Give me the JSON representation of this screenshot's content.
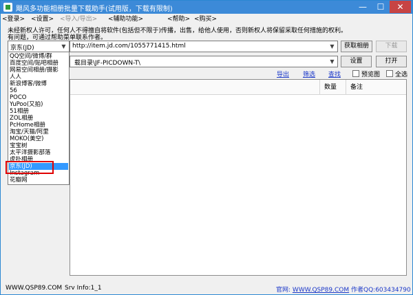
{
  "window": {
    "title": "飓风多功能相册批量下载助手(试用版，下载有限制)",
    "controls": {
      "minimize": "—",
      "maximize": "☐",
      "close": "✕"
    }
  },
  "menu": [
    {
      "label": "<登录>",
      "enabled": true
    },
    {
      "label": "<设置>",
      "enabled": true
    },
    {
      "label": "<导入/导出>",
      "enabled": false
    },
    {
      "label": "<辅助功能>",
      "enabled": true
    },
    {
      "label": "<帮助>",
      "enabled": true
    },
    {
      "label": "<购买>",
      "enabled": true
    }
  ],
  "notice": {
    "line1": "未经新权人许可，任何人不得擅自将软件(包括但不限于)传播，出售，给他人使用，否则新权人将保留采取任何措施的权利。",
    "line2": "有问题，可通过帮助菜单联系作者。"
  },
  "source": {
    "selected": "京东(JD)",
    "url": "http://item.jd.com/1055771415.html",
    "fetch_button": "获取相册",
    "download_button": "下载"
  },
  "save": {
    "path_fragment": "载目录\\JF-PICDOWN-T\\",
    "settings_button": "设置",
    "open_button": "打开"
  },
  "actions": {
    "export": "导出",
    "filter": "筛选",
    "find": "查找",
    "preview_label": "预览图",
    "select_all_label": "全选"
  },
  "table": {
    "columns": [
      "数量",
      "备注"
    ]
  },
  "dropdown_options": [
    "QQ空间/微博/群",
    "百度空间/贴吧相册",
    "网易空间相册/摄影",
    "人人",
    "新浪博客/微博",
    "56",
    "POCO",
    "YuPoo(又拍)",
    "51相册",
    "ZOL相册",
    "PcHome相册",
    "淘宝/天猫/阿里",
    "MOKO(美空)",
    "宝宝树",
    "太平洋摄影部落",
    "虎扑相册",
    "京东(JD)",
    "Instagram",
    "花瓣网"
  ],
  "dropdown_selected_index": 16,
  "status": {
    "site": "WWW.QSP89.COM",
    "srv_info": "Srv Info:1_1",
    "official_label": "官网:",
    "official_url": "WWW.QSP89.COM",
    "author_label": "作者QQ:",
    "author_qq": "603434790"
  },
  "colors": {
    "titlebar": "#3c8ad8",
    "selection": "#3399ff",
    "highlight": "#e00000",
    "link": "#1a37c8"
  }
}
